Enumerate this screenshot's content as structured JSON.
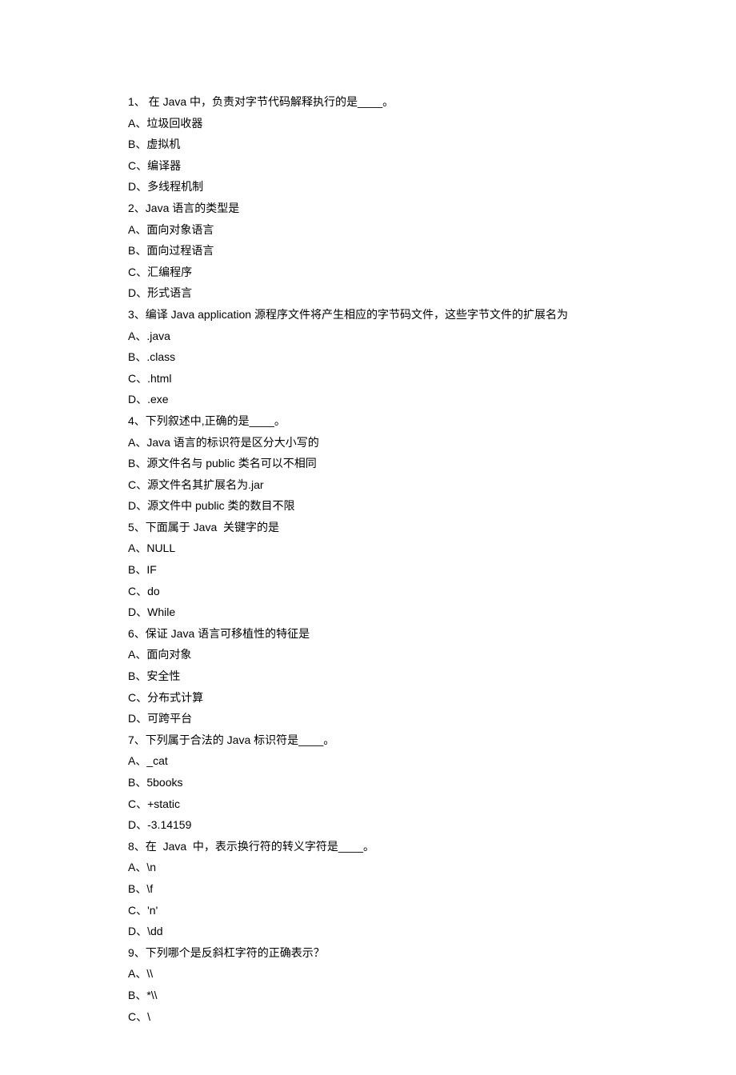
{
  "questions": [
    {
      "num": "1、",
      "stem": " 在 Java 中，负责对字节代码解释执行的是____。",
      "opts": [
        "A、垃圾回收器",
        "B、虚拟机",
        "C、编译器",
        "D、多线程机制"
      ]
    },
    {
      "num": "2、",
      "stem": "Java 语言的类型是",
      "opts": [
        "A、面向对象语言",
        "B、面向过程语言",
        "C、汇编程序",
        "D、形式语言"
      ]
    },
    {
      "num": "3、",
      "stem": "编译 Java application 源程序文件将产生相应的字节码文件，这些字节文件的扩展名为",
      "opts": [
        "A、.java",
        "B、.class",
        "C、.html",
        "D、.exe"
      ]
    },
    {
      "num": "4、",
      "stem": "下列叙述中,正确的是____。",
      "opts": [
        "A、Java 语言的标识符是区分大小写的",
        "B、源文件名与 public 类名可以不相同",
        "C、源文件名其扩展名为.jar",
        "D、源文件中 public 类的数目不限"
      ]
    },
    {
      "num": "5、",
      "stem": "下面属于 Java  关键字的是",
      "opts": [
        "A、NULL",
        "B、IF",
        "C、do",
        "D、While"
      ]
    },
    {
      "num": "6、",
      "stem": "保证 Java 语言可移植性的特征是",
      "opts": [
        "A、面向对象",
        "B、安全性",
        "C、分布式计算",
        "D、可跨平台"
      ]
    },
    {
      "num": "7、",
      "stem": "下列属于合法的 Java 标识符是____。",
      "opts": [
        "A、_cat",
        "B、5books",
        "C、+static",
        "D、-3.14159"
      ]
    },
    {
      "num": "8、",
      "stem": "在  Java  中，表示换行符的转义字符是____。",
      "opts": [
        "A、\\n",
        "B、\\f",
        "C、'n'",
        "D、\\dd"
      ]
    },
    {
      "num": "9、",
      "stem": "下列哪个是反斜杠字符的正确表示？",
      "opts": [
        "A、\\\\",
        "B、*\\\\",
        "C、\\"
      ]
    }
  ]
}
